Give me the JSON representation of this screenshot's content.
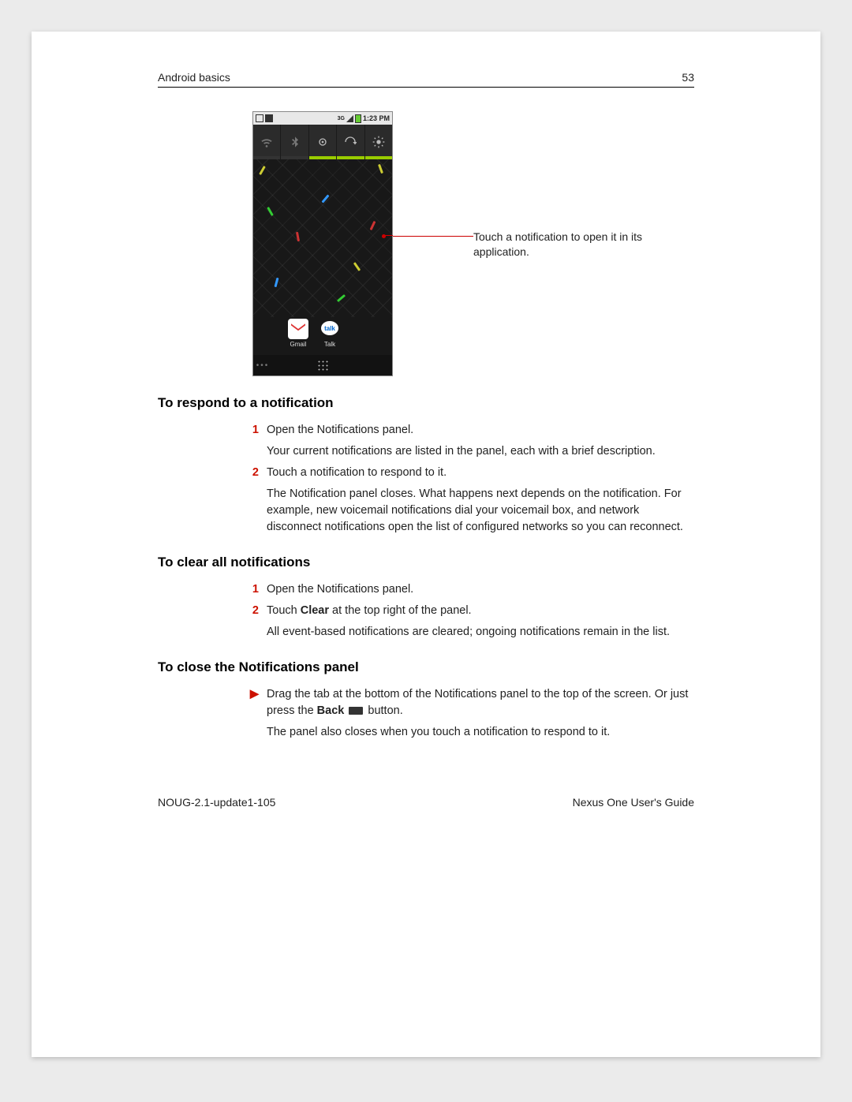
{
  "header": {
    "chapter": "Android basics",
    "page": "53"
  },
  "screenshot": {
    "time": "1:23 PM",
    "net_label": "3G",
    "apps": {
      "gmail": "Gmail",
      "talk": "Talk"
    }
  },
  "callout": "Touch a notification to open it in its application.",
  "sections": [
    {
      "title": "To respond to a notification",
      "steps": [
        {
          "n": "1",
          "text": "Open the Notifications panel.",
          "sub": "Your current notifications are listed in the panel, each with a brief description."
        },
        {
          "n": "2",
          "text": "Touch a notification to respond to it.",
          "sub": "The Notification panel closes. What happens next depends on the notification. For example, new voicemail notifications dial your voicemail box, and network disconnect notifications open the list of configured networks so you can reconnect."
        }
      ]
    },
    {
      "title": "To clear all notifications",
      "steps": [
        {
          "n": "1",
          "text": "Open the Notifications panel."
        },
        {
          "n": "2",
          "pre": "Touch ",
          "bold": "Clear",
          "post": " at the top right of the panel.",
          "sub": "All event-based notifications are cleared; ongoing notifications remain in the list."
        }
      ]
    },
    {
      "title": "To close the Notifications panel",
      "steps": [
        {
          "bullet": "▶",
          "pre": "Drag the tab at the bottom of the Notifications panel to the top of the screen. Or just press the ",
          "bold": "Back",
          "back_icon": true,
          "post": " button.",
          "sub": "The panel also closes when you touch a notification to respond to it."
        }
      ]
    }
  ],
  "footer": {
    "left": "NOUG-2.1-update1-105",
    "right": "Nexus One User's Guide"
  }
}
